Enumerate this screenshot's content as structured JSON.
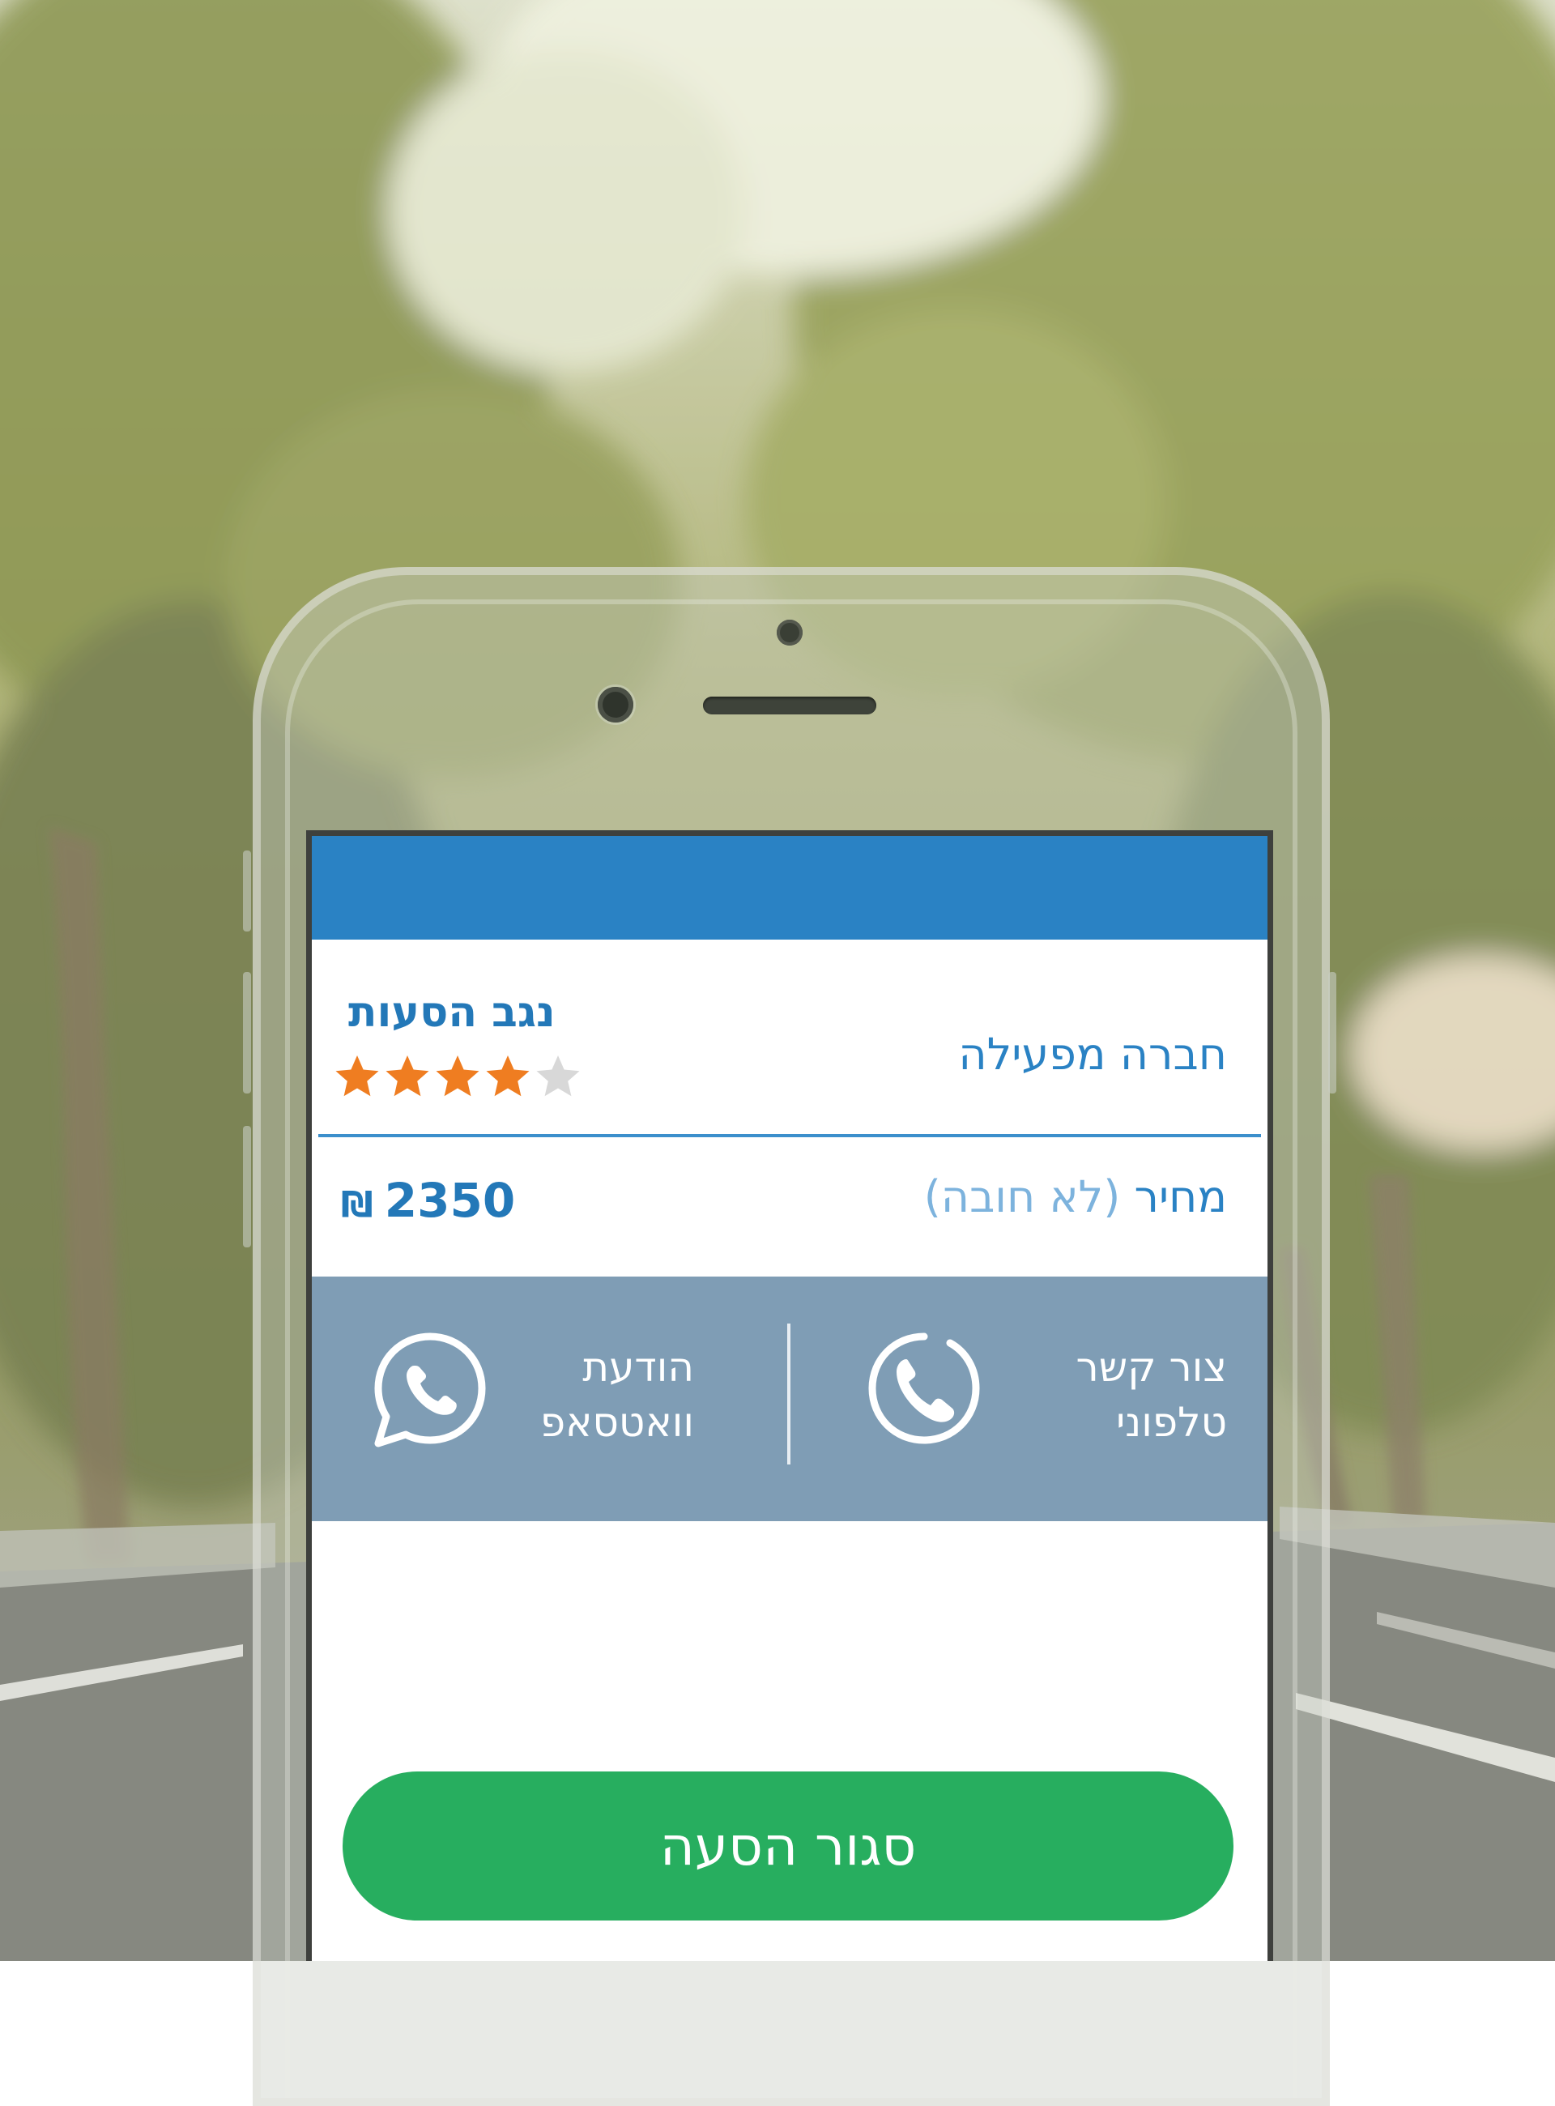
{
  "colors": {
    "header_blue": "#2a82c4",
    "text_blue": "#2378b8",
    "contact_band": "#7f9db5",
    "button_green": "#27ae5f",
    "star_filled": "#ef7d21",
    "star_empty": "#d8d8d8"
  },
  "card": {
    "company_label": "חברה מפעילה",
    "company_name": "נגב הסעות",
    "rating": {
      "value": 4,
      "max": 5
    },
    "price": {
      "label": "מחיר",
      "note": "(לא חובה)",
      "amount": "2350",
      "currency": "₪"
    }
  },
  "contact": {
    "phone": {
      "line1": "צור קשר",
      "line2": "טלפוני",
      "icon": "phone-icon"
    },
    "whatsapp": {
      "line1": "הודעת",
      "line2": "וואטסאפ",
      "icon": "whatsapp-icon"
    }
  },
  "actions": {
    "close_ride_label": "סגור הסעה"
  }
}
